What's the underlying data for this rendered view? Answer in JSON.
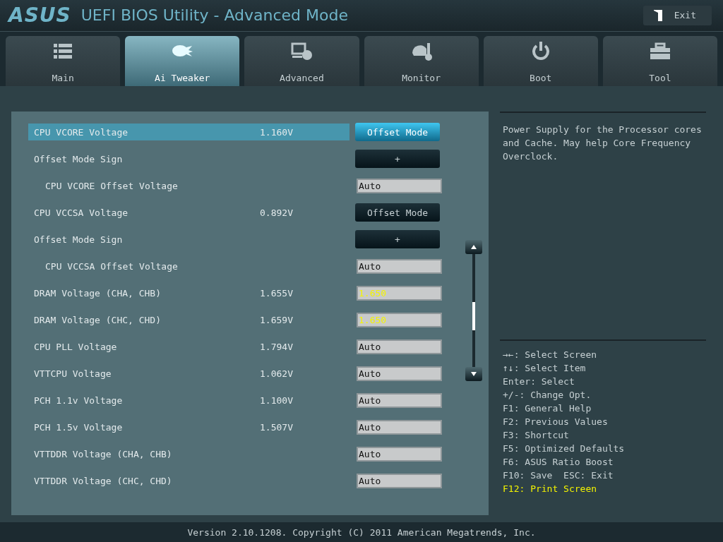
{
  "header": {
    "logo": "ASUS",
    "title": "UEFI BIOS Utility - Advanced Mode",
    "exit_button": "Exit"
  },
  "tabs": [
    {
      "label": "Main",
      "kind": "list",
      "selected": false
    },
    {
      "label": "Ai Tweaker",
      "kind": "tweak",
      "selected": true
    },
    {
      "label": "Advanced",
      "kind": "info",
      "selected": false
    },
    {
      "label": "Monitor",
      "kind": "gauge",
      "selected": false
    },
    {
      "label": "Boot",
      "kind": "power",
      "selected": false
    },
    {
      "label": "Tool",
      "kind": "toolbox",
      "selected": false
    }
  ],
  "settings": [
    {
      "name": "CPU VCORE Voltage",
      "reading": "1.160V",
      "kind": "button",
      "value": "Offset Mode",
      "selected": true
    },
    {
      "name": "Offset Mode Sign",
      "kind": "button",
      "value": "+",
      "selected": false,
      "children": [
        {
          "name": "CPU VCORE Offset Voltage",
          "kind": "field",
          "value": "Auto",
          "modified": false
        }
      ]
    },
    {
      "name": "CPU VCCSA Voltage",
      "reading": "0.892V",
      "kind": "button",
      "value": "Offset Mode",
      "selected": false
    },
    {
      "name": "Offset Mode Sign",
      "kind": "button",
      "value": "+",
      "selected": false,
      "children": [
        {
          "name": "CPU VCCSA Offset Voltage",
          "kind": "field",
          "value": "Auto",
          "modified": false
        }
      ]
    },
    {
      "name": "DRAM Voltage (CHA, CHB)",
      "reading": "1.655V",
      "kind": "field",
      "value": "1.650",
      "modified": true
    },
    {
      "name": "DRAM Voltage (CHC, CHD)",
      "reading": "1.659V",
      "kind": "field",
      "value": "1.650",
      "modified": true
    },
    {
      "name": "CPU PLL Voltage",
      "reading": "1.794V",
      "kind": "field",
      "value": "Auto",
      "modified": false
    },
    {
      "name": "VTTCPU Voltage",
      "reading": "1.062V",
      "kind": "field",
      "value": "Auto",
      "modified": false
    },
    {
      "name": "PCH 1.1v Voltage",
      "reading": "1.100V",
      "kind": "field",
      "value": "Auto",
      "modified": false
    },
    {
      "name": "PCH 1.5v Voltage",
      "reading": "1.507V",
      "kind": "field",
      "value": "Auto",
      "modified": false
    },
    {
      "name": "VTTDDR Voltage (CHA, CHB)",
      "kind": "field",
      "value": "Auto",
      "modified": false
    },
    {
      "name": "VTTDDR Voltage (CHC, CHD)",
      "kind": "field",
      "value": "Auto",
      "modified": false
    }
  ],
  "help": {
    "description": "Power Supply for the Processor cores and Cache. May help Core Frequency Overclock.",
    "keys": [
      {
        "text": "→←: Select Screen",
        "highlighted": false
      },
      {
        "text": "↑↓: Select Item",
        "highlighted": false
      },
      {
        "text": "Enter: Select",
        "highlighted": false
      },
      {
        "text": "+/-: Change Opt.",
        "highlighted": false
      },
      {
        "text": "F1: General Help",
        "highlighted": false
      },
      {
        "text": "F2: Previous Values",
        "highlighted": false
      },
      {
        "text": "F3: Shortcut",
        "highlighted": false
      },
      {
        "text": "F5: Optimized Defaults",
        "highlighted": false
      },
      {
        "text": "F6: ASUS Ratio Boost",
        "highlighted": false
      },
      {
        "text": "F10: Save  ESC: Exit",
        "highlighted": false
      },
      {
        "text": "F12: Print Screen",
        "highlighted": true
      }
    ]
  },
  "footer": "Version 2.10.1208. Copyright (C) 2011 American Megatrends, Inc."
}
